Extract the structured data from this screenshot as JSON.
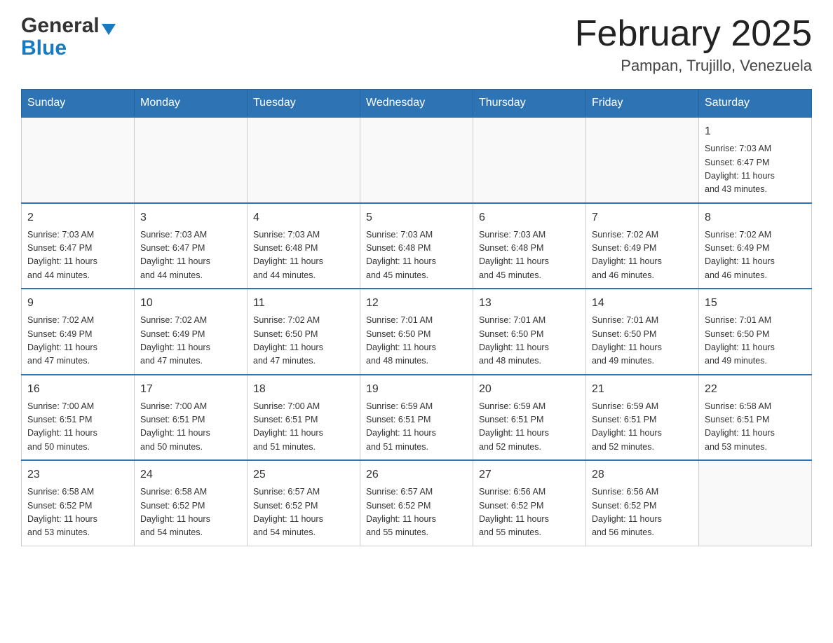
{
  "header": {
    "logo_general": "General",
    "logo_blue": "Blue",
    "month_title": "February 2025",
    "location": "Pampan, Trujillo, Venezuela"
  },
  "weekdays": [
    "Sunday",
    "Monday",
    "Tuesday",
    "Wednesday",
    "Thursday",
    "Friday",
    "Saturday"
  ],
  "weeks": [
    [
      {
        "day": "",
        "info": ""
      },
      {
        "day": "",
        "info": ""
      },
      {
        "day": "",
        "info": ""
      },
      {
        "day": "",
        "info": ""
      },
      {
        "day": "",
        "info": ""
      },
      {
        "day": "",
        "info": ""
      },
      {
        "day": "1",
        "info": "Sunrise: 7:03 AM\nSunset: 6:47 PM\nDaylight: 11 hours\nand 43 minutes."
      }
    ],
    [
      {
        "day": "2",
        "info": "Sunrise: 7:03 AM\nSunset: 6:47 PM\nDaylight: 11 hours\nand 44 minutes."
      },
      {
        "day": "3",
        "info": "Sunrise: 7:03 AM\nSunset: 6:47 PM\nDaylight: 11 hours\nand 44 minutes."
      },
      {
        "day": "4",
        "info": "Sunrise: 7:03 AM\nSunset: 6:48 PM\nDaylight: 11 hours\nand 44 minutes."
      },
      {
        "day": "5",
        "info": "Sunrise: 7:03 AM\nSunset: 6:48 PM\nDaylight: 11 hours\nand 45 minutes."
      },
      {
        "day": "6",
        "info": "Sunrise: 7:03 AM\nSunset: 6:48 PM\nDaylight: 11 hours\nand 45 minutes."
      },
      {
        "day": "7",
        "info": "Sunrise: 7:02 AM\nSunset: 6:49 PM\nDaylight: 11 hours\nand 46 minutes."
      },
      {
        "day": "8",
        "info": "Sunrise: 7:02 AM\nSunset: 6:49 PM\nDaylight: 11 hours\nand 46 minutes."
      }
    ],
    [
      {
        "day": "9",
        "info": "Sunrise: 7:02 AM\nSunset: 6:49 PM\nDaylight: 11 hours\nand 47 minutes."
      },
      {
        "day": "10",
        "info": "Sunrise: 7:02 AM\nSunset: 6:49 PM\nDaylight: 11 hours\nand 47 minutes."
      },
      {
        "day": "11",
        "info": "Sunrise: 7:02 AM\nSunset: 6:50 PM\nDaylight: 11 hours\nand 47 minutes."
      },
      {
        "day": "12",
        "info": "Sunrise: 7:01 AM\nSunset: 6:50 PM\nDaylight: 11 hours\nand 48 minutes."
      },
      {
        "day": "13",
        "info": "Sunrise: 7:01 AM\nSunset: 6:50 PM\nDaylight: 11 hours\nand 48 minutes."
      },
      {
        "day": "14",
        "info": "Sunrise: 7:01 AM\nSunset: 6:50 PM\nDaylight: 11 hours\nand 49 minutes."
      },
      {
        "day": "15",
        "info": "Sunrise: 7:01 AM\nSunset: 6:50 PM\nDaylight: 11 hours\nand 49 minutes."
      }
    ],
    [
      {
        "day": "16",
        "info": "Sunrise: 7:00 AM\nSunset: 6:51 PM\nDaylight: 11 hours\nand 50 minutes."
      },
      {
        "day": "17",
        "info": "Sunrise: 7:00 AM\nSunset: 6:51 PM\nDaylight: 11 hours\nand 50 minutes."
      },
      {
        "day": "18",
        "info": "Sunrise: 7:00 AM\nSunset: 6:51 PM\nDaylight: 11 hours\nand 51 minutes."
      },
      {
        "day": "19",
        "info": "Sunrise: 6:59 AM\nSunset: 6:51 PM\nDaylight: 11 hours\nand 51 minutes."
      },
      {
        "day": "20",
        "info": "Sunrise: 6:59 AM\nSunset: 6:51 PM\nDaylight: 11 hours\nand 52 minutes."
      },
      {
        "day": "21",
        "info": "Sunrise: 6:59 AM\nSunset: 6:51 PM\nDaylight: 11 hours\nand 52 minutes."
      },
      {
        "day": "22",
        "info": "Sunrise: 6:58 AM\nSunset: 6:51 PM\nDaylight: 11 hours\nand 53 minutes."
      }
    ],
    [
      {
        "day": "23",
        "info": "Sunrise: 6:58 AM\nSunset: 6:52 PM\nDaylight: 11 hours\nand 53 minutes."
      },
      {
        "day": "24",
        "info": "Sunrise: 6:58 AM\nSunset: 6:52 PM\nDaylight: 11 hours\nand 54 minutes."
      },
      {
        "day": "25",
        "info": "Sunrise: 6:57 AM\nSunset: 6:52 PM\nDaylight: 11 hours\nand 54 minutes."
      },
      {
        "day": "26",
        "info": "Sunrise: 6:57 AM\nSunset: 6:52 PM\nDaylight: 11 hours\nand 55 minutes."
      },
      {
        "day": "27",
        "info": "Sunrise: 6:56 AM\nSunset: 6:52 PM\nDaylight: 11 hours\nand 55 minutes."
      },
      {
        "day": "28",
        "info": "Sunrise: 6:56 AM\nSunset: 6:52 PM\nDaylight: 11 hours\nand 56 minutes."
      },
      {
        "day": "",
        "info": ""
      }
    ]
  ]
}
